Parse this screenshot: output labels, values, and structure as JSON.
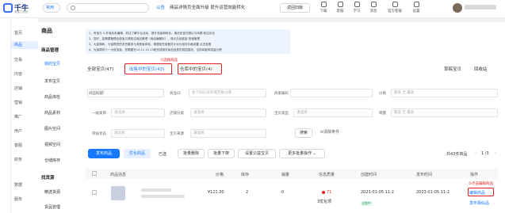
{
  "header": {
    "logo_text": "千牛",
    "logo_sub": "卖家工作台",
    "scope_select": "常用",
    "notice_tag": "公告",
    "notice_text": "商品详情页全面升级 提升运营效能转化",
    "old_version_btn": "返回旧版",
    "tools": [
      "下载",
      "客服",
      "学习",
      "消息",
      "官方客服",
      "设置"
    ]
  },
  "rail": {
    "items": [
      "首页",
      "商品",
      "交易",
      "内容",
      "店铺",
      "营销",
      "推广",
      "用户",
      "客服",
      "财务",
      "数据",
      "服务"
    ]
  },
  "leftnav": {
    "title": "商品",
    "groups": [
      {
        "head": "商品管理",
        "items": [
          "我的宝贝",
          "发布宝贝",
          "商品体检",
          "商品素材",
          "图片空间",
          "视频空间",
          "仓储库存"
        ]
      },
      {
        "head": "找货源",
        "items": [
          "精选货源",
          "货品管理"
        ]
      }
    ]
  },
  "tips": {
    "lines": [
      "1、有宝贝 0 件商品未编辑，前往了解平台活动，提升流量和转化，请优化宝贝图片与标题 前往优化",
      "2、您好，若需要管理全部宝贝请前往商品管理（商品编辑页），请点击此链接 快速管理",
      "3、大促期间，为保障您的发货要求与消费者体验，请提前完成备货计划与相关价格设置 点击查看",
      "4、为保障双十一大促流量，您需要在10.12-10.13前完成相关商品信息的规范整改，否则将影响流量分配"
    ]
  },
  "tabs": {
    "all": "全部宝贝(47)",
    "selling": "出售中的宝贝(43)",
    "warehouse": "仓库中的宝贝(4)",
    "draft": "草稿宝贝",
    "recycle": "回收站"
  },
  "annotations": {
    "step1": "①选择商品",
    "step2": "②点击编辑商品"
  },
  "filters": {
    "row1": [
      {
        "label": "商品标题",
        "placeholder": ""
      },
      {
        "label": "商品ID",
        "placeholder": "多个ID以逗号或空格分隔"
      },
      {
        "label": "商家编码",
        "placeholder": ""
      },
      {
        "label": "价格",
        "placeholder": "最低 至 最高"
      }
    ],
    "row2": [
      {
        "label": "一级类目",
        "placeholder": "请选择"
      },
      {
        "label": "店铺分类",
        "placeholder": "请选择"
      },
      {
        "label": "宝贝类型",
        "placeholder": "请选择"
      },
      {
        "label": "销量",
        "placeholder": "最低 至 最高"
      }
    ],
    "row3": [
      {
        "label": "审核状态",
        "placeholder": "请选择"
      },
      {
        "label": "宝贝来源",
        "placeholder": "请选择"
      }
    ],
    "search_btn": "搜索",
    "clear_btn": "清除条件"
  },
  "toolbar": {
    "publish": "发布商品",
    "optimize": "优化商品",
    "selected": "已选",
    "batch_delete": "批量删除",
    "batch_offline": "批量下架",
    "set_public": "设置公益宝贝",
    "more_batch": "更多批量操作",
    "total": "共43件商品",
    "page": "1 /3"
  },
  "table": {
    "headers": [
      "商品信息",
      "价格",
      "库存",
      "销量",
      "信息质量",
      "创建时间",
      "发布时间",
      "操作"
    ],
    "row": {
      "price": "¥111.00",
      "stock": "2",
      "sales": "0",
      "quality_score": "71",
      "quality_note": "3优化项",
      "created": "2023-01-05 11:2",
      "published": "2023-01-05 11:2",
      "status_badge": "出售中",
      "action_edit": "编辑商品",
      "action_publish_similar": "发布相似品"
    }
  }
}
